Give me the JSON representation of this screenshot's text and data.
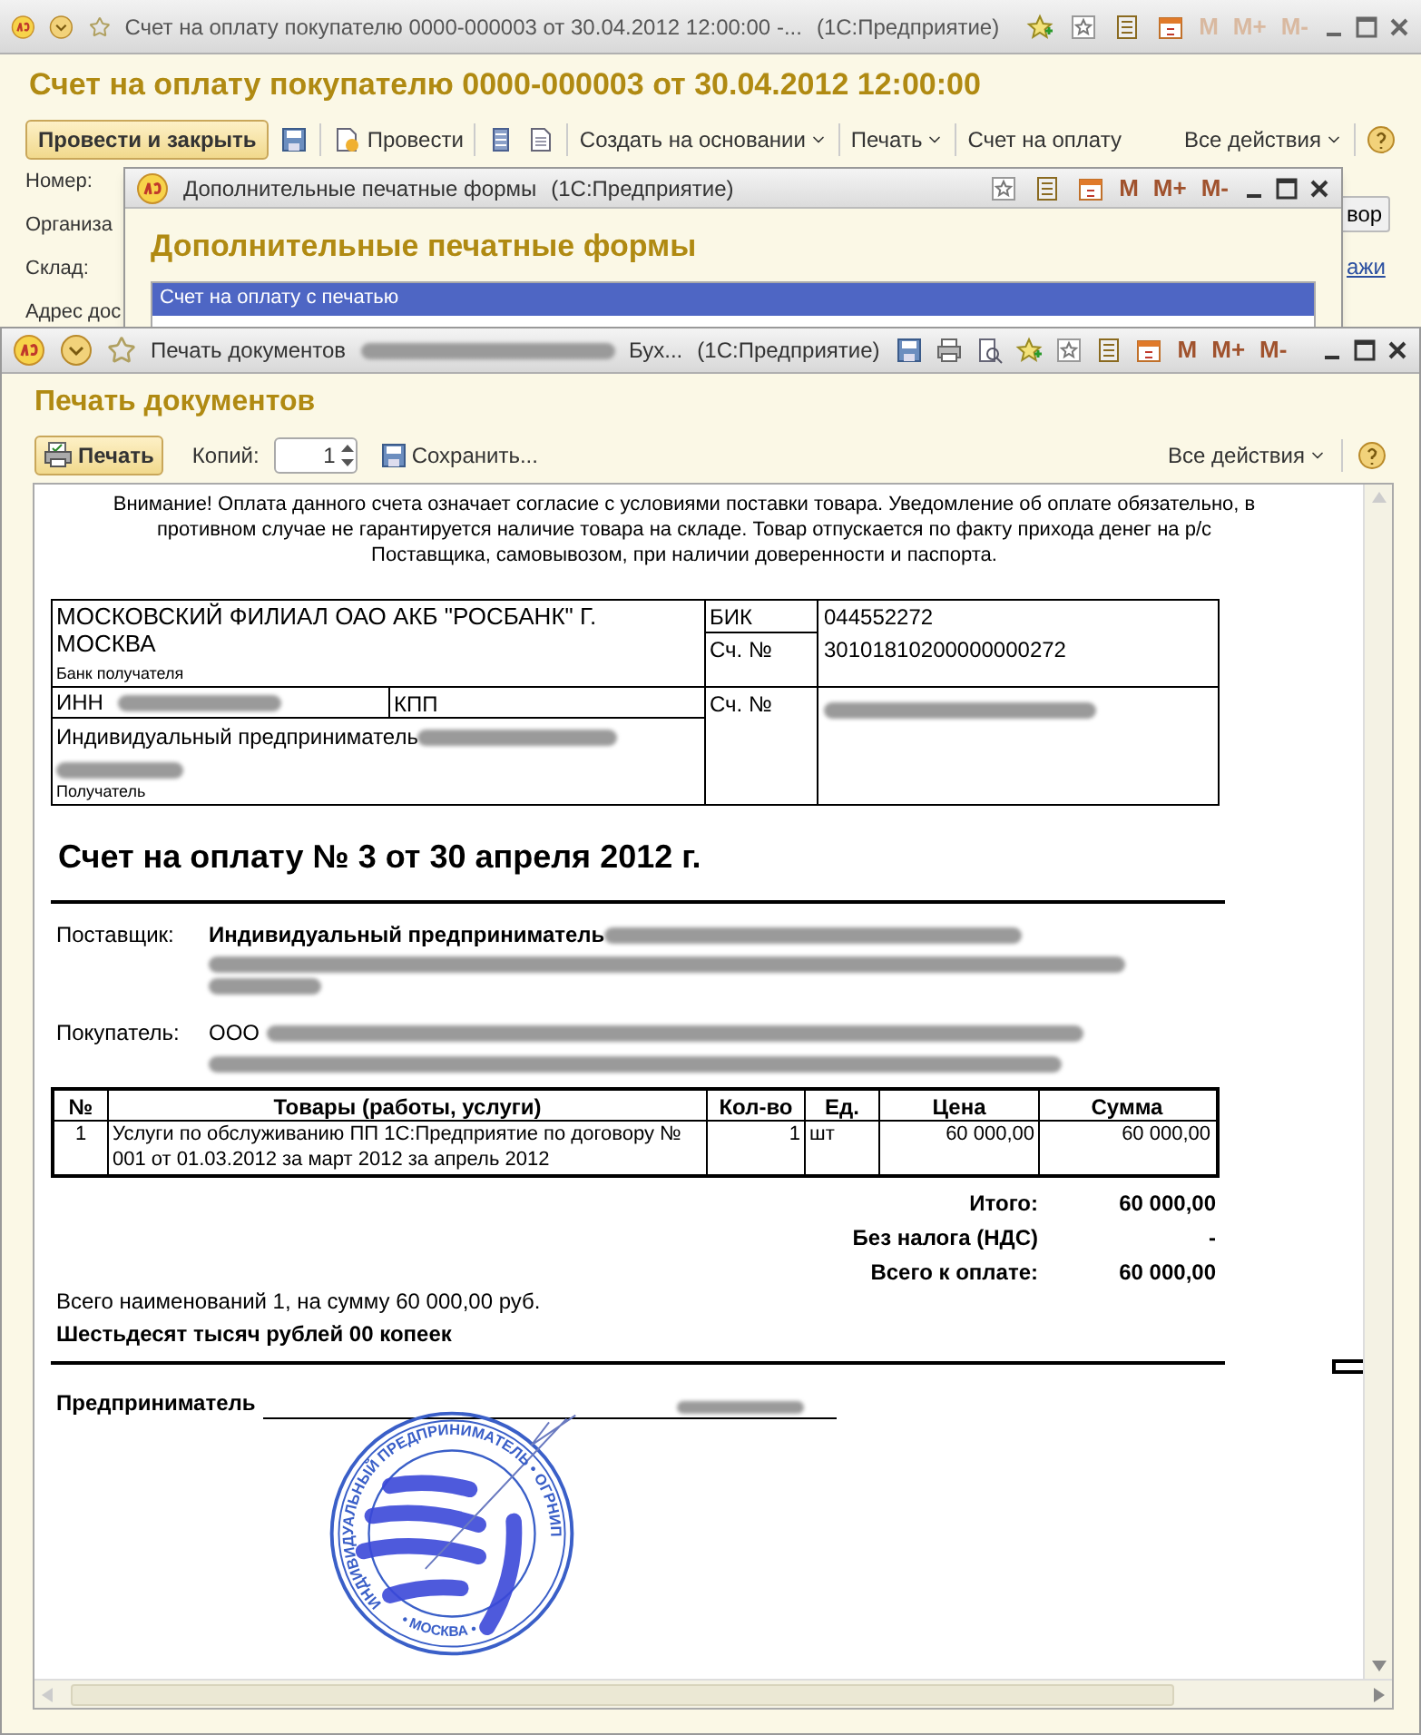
{
  "main_window": {
    "title": "Счет на оплату покупателю 0000-000003 от 30.04.2012 12:00:00 -...",
    "app": "(1С:Предприятие)",
    "memory_buttons": [
      "M",
      "M+",
      "M-"
    ],
    "heading": "Счет на оплату покупателю 0000-000003 от 30.04.2012 12:00:00",
    "toolbar": {
      "post_close": "Провести и закрыть",
      "post": "Провести",
      "create_based": "Создать на основании",
      "print": "Печать",
      "invoice": "Счет на оплату",
      "all_actions": "Все действия"
    },
    "fields": [
      "Номер:",
      "Организа",
      "Склад:",
      "Адрес дос"
    ],
    "right_fragments": [
      "вор",
      "ажи"
    ]
  },
  "dialog": {
    "title": "Дополнительные печатные формы",
    "app": "(1С:Предприятие)",
    "memory_buttons": [
      "M",
      "M+",
      "M-"
    ],
    "heading": "Дополнительные печатные формы",
    "list": [
      {
        "label": "Счет на оплату с печатью",
        "selected": true
      }
    ]
  },
  "print_window": {
    "title": "Печать документов",
    "title_tail": "Бух...",
    "app": "(1С:Предприятие)",
    "memory_buttons": [
      "M",
      "M+",
      "M-"
    ],
    "heading": "Печать документов",
    "toolbar": {
      "print": "Печать",
      "copies_label": "Копий:",
      "copies_value": "1",
      "save": "Сохранить...",
      "all_actions": "Все действия"
    }
  },
  "document": {
    "notice": "Внимание! Оплата данного счета означает согласие с условиями поставки товара. Уведомление об оплате обязательно, в противном случае не гарантируется наличие товара на складе. Товар отпускается по факту прихода денег на р/с Поставщика, самовывозом, при наличии доверенности и паспорта.",
    "bank": {
      "name": "МОСКОВСКИЙ ФИЛИАЛ ОАО АКБ \"РОСБАНК\" Г. МОСКВА",
      "bank_caption": "Банк получателя",
      "bik_label": "БИК",
      "bik": "044552272",
      "corr_label": "Сч. №",
      "corr": "30101810200000000272",
      "inn_label": "ИНН",
      "kpp_label": "КПП",
      "account_label": "Сч. №",
      "recipient": "Индивидуальный предприниматель",
      "recipient_caption": "Получатель"
    },
    "title": "Счет на оплату № 3 от 30 апреля 2012 г.",
    "supplier": {
      "label": "Поставщик:",
      "value": "Индивидуальный предприниматель"
    },
    "buyer": {
      "label": "Покупатель:",
      "value": "ООО"
    },
    "columns": [
      "№",
      "Товары (работы, услуги)",
      "Кол-во",
      "Ед.",
      "Цена",
      "Сумма"
    ],
    "rows": [
      [
        "1",
        "Услуги по обслуживанию ПП 1С:Предприятие по договору № 001 от 01.03.2012 за март 2012 за апрель 2012",
        "1",
        "шт",
        "60 000,00",
        "60 000,00"
      ]
    ],
    "totals": [
      {
        "label": "Итого:",
        "value": "60 000,00"
      },
      {
        "label": "Без налога (НДС)",
        "value": "-"
      },
      {
        "label": "Всего к оплате:",
        "value": "60 000,00"
      }
    ],
    "summary": "Всего наименований 1, на сумму 60 000,00 руб.",
    "amount_words": "Шестьдесят тысяч рублей 00 копеек",
    "signature_label": "Предприниматель",
    "stamp": {
      "top_text": "ИНДИВИДУАЛЬНЫЙ ПРЕДПРИНИМАТЕЛЬ • ОГРНИП",
      "bottom_text": "• МОСКВА •"
    }
  }
}
